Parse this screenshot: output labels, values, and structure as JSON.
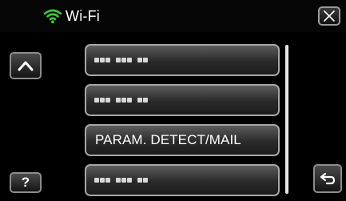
{
  "header": {
    "title": "Wi-Fi",
    "wifi_icon": "wifi-icon",
    "close_icon": "close-icon"
  },
  "nav": {
    "up_icon": "caret-up-icon",
    "help_label": "?",
    "back_icon": "return-icon"
  },
  "list": {
    "items": [
      {
        "type": "masked",
        "label": ""
      },
      {
        "type": "masked",
        "label": ""
      },
      {
        "type": "text",
        "label": "PARAM. DETECT/MAIL"
      },
      {
        "type": "masked",
        "label": ""
      }
    ]
  },
  "colors": {
    "wifi_accent": "#3ec93e",
    "button_border": "#a6a6a6",
    "background": "#000000"
  }
}
